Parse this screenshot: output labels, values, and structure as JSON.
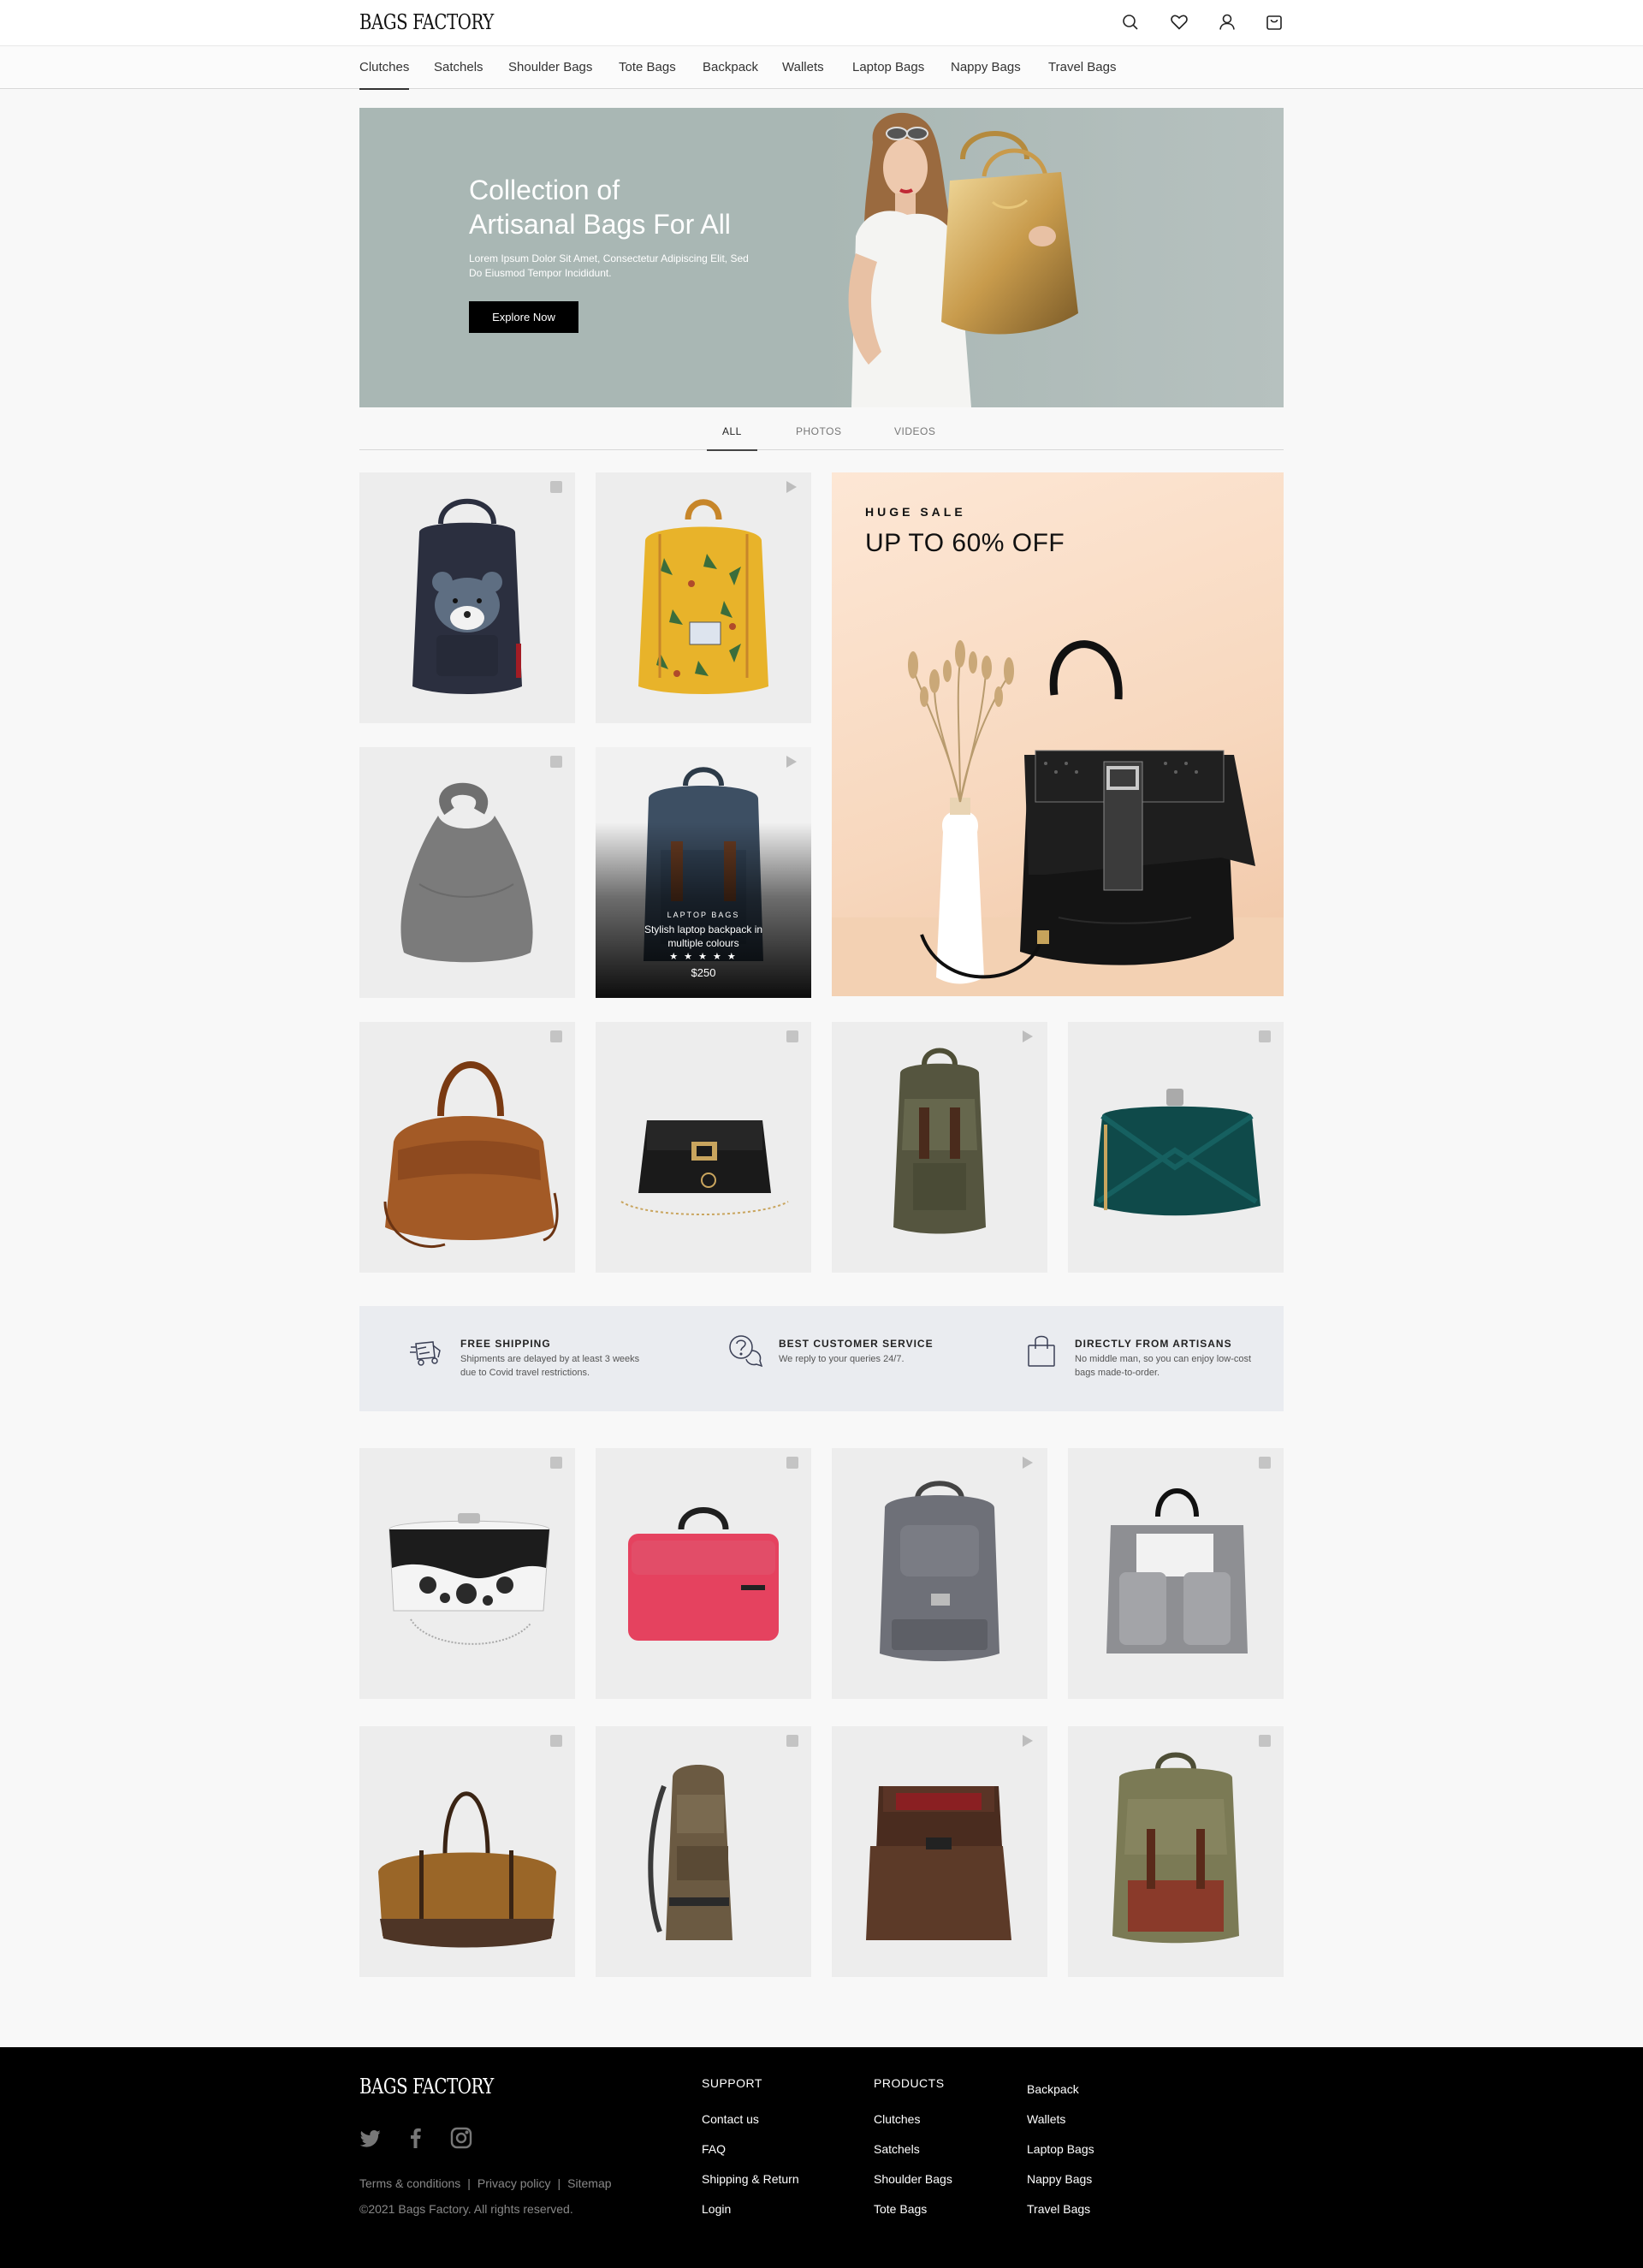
{
  "brand": {
    "name": "BAGS FACTORY"
  },
  "header": {
    "icons": [
      "search-icon",
      "heart-icon",
      "user-icon",
      "bag-icon"
    ]
  },
  "categories": [
    "Clutches",
    "Satchels",
    "Shoulder Bags",
    "Tote Bags",
    "Backpack",
    "Wallets",
    "Laptop Bags",
    "Nappy Bags",
    "Travel Bags"
  ],
  "active_category": "Clutches",
  "hero": {
    "title_line1": "Collection of",
    "title_line2": "Artisanal Bags For All",
    "subtitle": "Lorem Ipsum Dolor Sit Amet, Consectetur Adipiscing Elit, Sed Do Eiusmod Tempor Incididunt.",
    "button": "Explore Now"
  },
  "media_tabs": [
    "ALL",
    "PHOTOS",
    "VIDEOS"
  ],
  "active_media_tab": "ALL",
  "products": [
    {
      "name": "Navy bear nappy backpack",
      "media": "photo",
      "color": "#2b2f3f"
    },
    {
      "name": "Yellow patterned backpack",
      "media": "video",
      "color": "#e8b32a"
    },
    {
      "name": "Grey hobo bag",
      "media": "photo",
      "color": "#7a7a7a"
    },
    {
      "name": "Brown leather satchel",
      "media": "photo",
      "color": "#8e4a1f"
    },
    {
      "name": "Black chain crossbody",
      "media": "photo",
      "color": "#1a1a1a"
    },
    {
      "name": "Olive canvas backpack",
      "media": "video",
      "color": "#55553f"
    },
    {
      "name": "Teal velvet clutch",
      "media": "photo",
      "color": "#0f4a4a"
    },
    {
      "name": "Black and white beaded clutch",
      "media": "photo",
      "color": "#222222"
    },
    {
      "name": "Pink laptop bag",
      "media": "photo",
      "color": "#e5425f"
    },
    {
      "name": "Grey nappy backpack",
      "media": "video",
      "color": "#6e7078"
    },
    {
      "name": "Grey felt tote",
      "media": "photo",
      "color": "#8e8f93"
    },
    {
      "name": "Tan leather duffel",
      "media": "photo",
      "color": "#9a6628"
    },
    {
      "name": "Khaki travel backpack",
      "media": "photo",
      "color": "#6b5a42"
    },
    {
      "name": "Brown leather messenger",
      "media": "video",
      "color": "#4a2c1f"
    },
    {
      "name": "Army green rucksack",
      "media": "photo",
      "color": "#7b7a55"
    }
  ],
  "featured": {
    "category": "LAPTOP BAGS",
    "name": "Stylish laptop backpack in multiple colours",
    "stars": "★ ★ ★ ★ ★",
    "rating": 5,
    "price": "$250",
    "media": "video"
  },
  "sale": {
    "kicker": "HUGE SALE",
    "title": "UP TO 60% OFF"
  },
  "features": [
    {
      "icon": "delivery-icon",
      "title": "FREE SHIPPING",
      "text": "Shipments are delayed by at least 3 weeks due to Covid travel restrictions."
    },
    {
      "icon": "question-chat-icon",
      "title": "BEST CUSTOMER SERVICE",
      "text": "We reply to your queries 24/7."
    },
    {
      "icon": "shopping-bag-icon",
      "title": "DIRECTLY FROM ARTISANS",
      "text": "No middle man, so you can enjoy low-cost bags made-to-order."
    }
  ],
  "footer": {
    "social": [
      "twitter-icon",
      "facebook-icon",
      "instagram-icon"
    ],
    "legal": [
      "Terms & conditions",
      "Privacy policy",
      "Sitemap"
    ],
    "copyright": "©2021 Bags Factory. All rights reserved.",
    "support_heading": "SUPPORT",
    "support_links": [
      "Contact us",
      "FAQ",
      "Shipping & Return",
      "Login"
    ],
    "products_heading": "PRODUCTS",
    "products_col1": [
      "Clutches",
      "Satchels",
      "Shoulder Bags",
      "Tote Bags"
    ],
    "products_col2": [
      "Backpack",
      "Wallets",
      "Laptop Bags",
      "Nappy Bags",
      "Travel Bags"
    ]
  }
}
